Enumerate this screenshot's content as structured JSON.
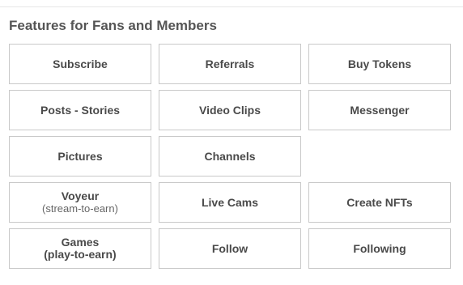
{
  "section": {
    "title": "Features for Fans and Members"
  },
  "tiles": [
    {
      "label": "Subscribe"
    },
    {
      "label": "Referrals"
    },
    {
      "label": "Buy Tokens"
    },
    {
      "label": "Posts - Stories"
    },
    {
      "label": "Video Clips"
    },
    {
      "label": "Messenger"
    },
    {
      "label": "Pictures"
    },
    {
      "label": "Channels"
    },
    {
      "label": ""
    },
    {
      "label": "Voyeur",
      "sub": "(stream-to-earn)"
    },
    {
      "label": "Live Cams"
    },
    {
      "label": "Create NFTs"
    },
    {
      "label": "Games",
      "sub": "(play-to-earn)"
    },
    {
      "label": "Follow"
    },
    {
      "label": "Following"
    }
  ]
}
